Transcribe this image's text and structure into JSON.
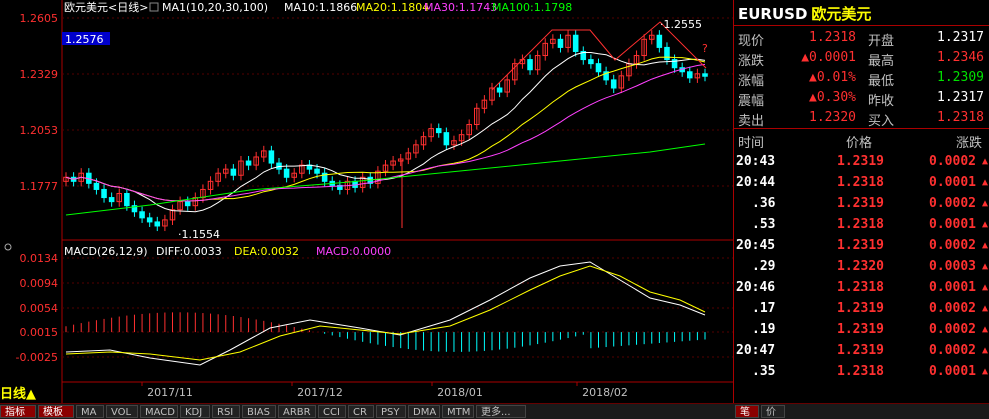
{
  "chart": {
    "symbol_name": "欧元美元",
    "period": "日线",
    "ma_legend": [
      {
        "text": "MA1(10,20,30,100)",
        "color": "#ffffff"
      },
      {
        "text": "MA10:1.1866",
        "color": "#ffffff"
      },
      {
        "text": "MA20:1.1804",
        "color": "#ffff00"
      },
      {
        "text": "MA30:1.1743",
        "color": "#ff40ff"
      },
      {
        "text": "MA100:1.1798",
        "color": "#00ff00"
      }
    ],
    "price_axis": [
      "1.2605",
      "1.2329",
      "1.2053",
      "1.1777"
    ],
    "cursor_price": "1.2576",
    "high_label": "1.2555",
    "low_label": "1.1554",
    "question_mark": "?",
    "macd_legend": [
      {
        "text": "MACD(26,12,9)",
        "color": "#ffffff"
      },
      {
        "text": "DIFF:0.0033",
        "color": "#ffffff"
      },
      {
        "text": "DEA:0.0032",
        "color": "#ffff00"
      },
      {
        "text": "MACD:0.0000",
        "color": "#ff40ff"
      }
    ],
    "macd_axis": [
      "0.0134",
      "0.0094",
      "0.0054",
      "0.0015",
      "-0.0025"
    ],
    "date_labels": [
      "2017/11",
      "2017/12",
      "2018/01",
      "2018/02"
    ],
    "colors": {
      "up": "#ff3030",
      "down": "#00ffff",
      "ma10": "#ffffff",
      "ma20": "#ffff00",
      "ma30": "#ff40ff",
      "ma100": "#00ff00"
    }
  },
  "quote": {
    "symbol": "EURUSD",
    "name": "欧元美元",
    "rows": [
      {
        "l1": "现价",
        "v1": "1.2318",
        "c1": "up",
        "l2": "开盘",
        "v2": "1.2317",
        "c2": "wht"
      },
      {
        "l1": "涨跌",
        "v1": "▲0.0001",
        "c1": "up",
        "l2": "最高",
        "v2": "1.2346",
        "c2": "up"
      },
      {
        "l1": "涨幅",
        "v1": "▲0.01%",
        "c1": "up",
        "l2": "最低",
        "v2": "1.2309",
        "c2": "dn"
      },
      {
        "l1": "震幅",
        "v1": "▲0.30%",
        "c1": "up",
        "l2": "昨收",
        "v2": "1.2317",
        "c2": "wht"
      },
      {
        "l1": "卖出",
        "v1": "1.2320",
        "c1": "up",
        "l2": "买入",
        "v2": "1.2318",
        "c2": "up"
      }
    ],
    "tick_headers": {
      "time": "时间",
      "price": "价格",
      "change": "涨跌"
    },
    "ticks": [
      {
        "time": "20:43",
        "price": "1.2319",
        "change": "0.0002",
        "arrow": "▲"
      },
      {
        "time": "20:44",
        "price": "1.2318",
        "change": "0.0001",
        "arrow": "▲"
      },
      {
        "time": ".36",
        "price": "1.2319",
        "change": "0.0002",
        "arrow": "▲"
      },
      {
        "time": ".53",
        "price": "1.2318",
        "change": "0.0001",
        "arrow": "▲"
      },
      {
        "time": "20:45",
        "price": "1.2319",
        "change": "0.0002",
        "arrow": "▲"
      },
      {
        "time": ".29",
        "price": "1.2320",
        "change": "0.0003",
        "arrow": "▲"
      },
      {
        "time": "20:46",
        "price": "1.2318",
        "change": "0.0001",
        "arrow": "▲"
      },
      {
        "time": ".17",
        "price": "1.2319",
        "change": "0.0002",
        "arrow": "▲"
      },
      {
        "time": ".19",
        "price": "1.2319",
        "change": "0.0002",
        "arrow": "▲"
      },
      {
        "time": "20:47",
        "price": "1.2319",
        "change": "0.0002",
        "arrow": "▲"
      },
      {
        "time": ".35",
        "price": "1.2318",
        "change": "0.0001",
        "arrow": "▲"
      }
    ]
  },
  "bottom_tabs": [
    "指标",
    "模板",
    "MA",
    "VOL",
    "MACD",
    "KDJ",
    "RSI",
    "BIAS",
    "ARBR",
    "CCI",
    "CR",
    "PSY",
    "DMA",
    "MTM",
    "更多..."
  ],
  "right_tabs": [
    "笔",
    "价"
  ],
  "period_label": "日线▲"
}
